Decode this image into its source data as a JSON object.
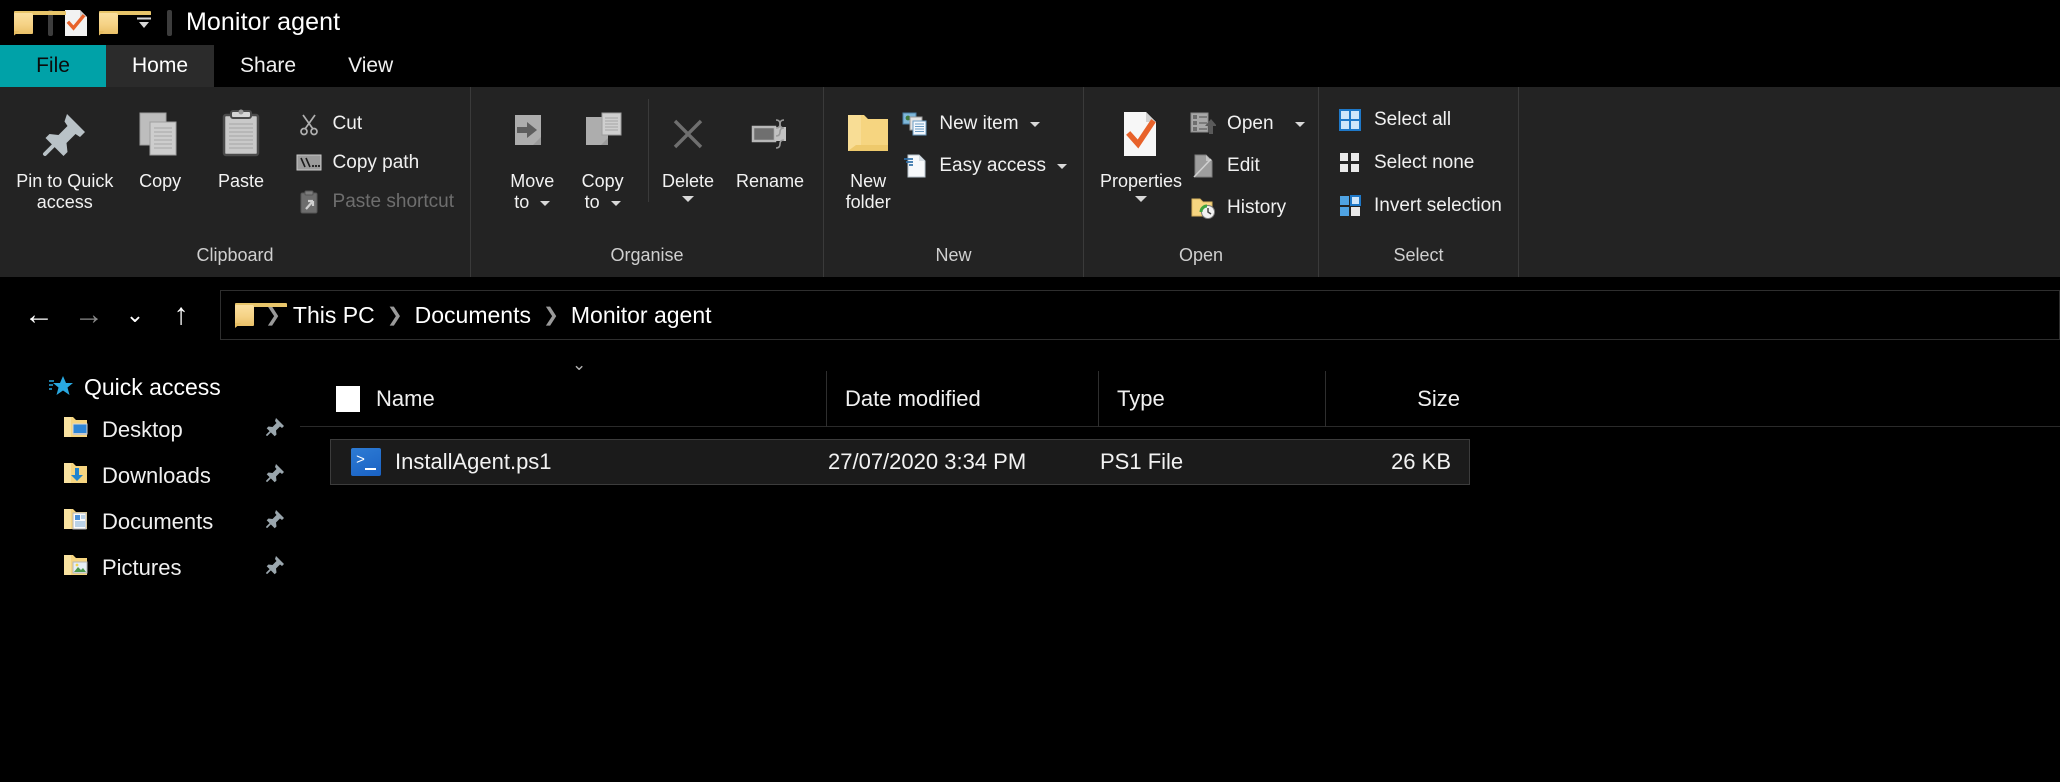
{
  "window": {
    "title": "Monitor agent",
    "accent_teal": "#00A2A8",
    "quick_access": [
      {
        "name": "folder-icon",
        "label": "New folder"
      },
      {
        "name": "properties-icon",
        "label": "Properties"
      },
      {
        "name": "folder-icon",
        "label": "Folder"
      }
    ],
    "customize_label": "Customize Quick Access Toolbar"
  },
  "tabs": [
    {
      "id": "file",
      "label": "File"
    },
    {
      "id": "home",
      "label": "Home"
    },
    {
      "id": "share",
      "label": "Share"
    },
    {
      "id": "view",
      "label": "View"
    }
  ],
  "ribbon": {
    "groups": [
      {
        "id": "clipboard",
        "label": "Clipboard",
        "big": [
          {
            "id": "pin-to-quick-access",
            "label": "Pin to Quick\naccess",
            "line1": "Pin to Quick",
            "line2": "access"
          },
          {
            "id": "copy",
            "label": "Copy"
          },
          {
            "id": "paste",
            "label": "Paste"
          }
        ],
        "small": [
          {
            "id": "cut",
            "label": "Cut",
            "enabled": true
          },
          {
            "id": "copy-path",
            "label": "Copy path",
            "enabled": true
          },
          {
            "id": "paste-shortcut",
            "label": "Paste shortcut",
            "enabled": false
          }
        ]
      },
      {
        "id": "organise",
        "label": "Organise",
        "big": [
          {
            "id": "move-to",
            "line1": "Move",
            "line2": "to",
            "has_caret": true
          },
          {
            "id": "copy-to",
            "line1": "Copy",
            "line2": "to",
            "has_caret": true
          },
          {
            "id": "delete",
            "label": "Delete",
            "has_caret": true
          },
          {
            "id": "rename",
            "label": "Rename",
            "has_caret": false
          }
        ]
      },
      {
        "id": "new",
        "label": "New",
        "big": [
          {
            "id": "new-folder",
            "line1": "New",
            "line2": "folder"
          }
        ],
        "small": [
          {
            "id": "new-item",
            "label": "New item",
            "has_caret": true
          },
          {
            "id": "easy-access",
            "label": "Easy access",
            "has_caret": true
          }
        ]
      },
      {
        "id": "open",
        "label": "Open",
        "big": [
          {
            "id": "properties",
            "label": "Properties",
            "has_caret": true
          }
        ],
        "small": [
          {
            "id": "open",
            "label": "Open",
            "has_caret": true
          },
          {
            "id": "edit",
            "label": "Edit",
            "has_caret": false
          },
          {
            "id": "history",
            "label": "History",
            "has_caret": false
          }
        ]
      },
      {
        "id": "select",
        "label": "Select",
        "small": [
          {
            "id": "select-all",
            "label": "Select all"
          },
          {
            "id": "select-none",
            "label": "Select none"
          },
          {
            "id": "invert-selection",
            "label": "Invert selection"
          }
        ]
      }
    ]
  },
  "navigation": {
    "back_icon": "←",
    "forward_icon": "→",
    "recent_icon": "⌄",
    "up_icon": "↑",
    "breadcrumb": [
      "This PC",
      "Documents",
      "Monitor agent"
    ],
    "separator": "❯"
  },
  "sidebar": {
    "root": {
      "label": "Quick access",
      "icon": "star-icon"
    },
    "items": [
      {
        "label": "Desktop",
        "icon": "folder-desktop-icon",
        "pinned": true
      },
      {
        "label": "Downloads",
        "icon": "folder-downloads-icon",
        "pinned": true
      },
      {
        "label": "Documents",
        "icon": "folder-documents-icon",
        "pinned": true
      },
      {
        "label": "Pictures",
        "icon": "folder-pictures-icon",
        "pinned": true
      }
    ]
  },
  "filelist": {
    "columns": [
      {
        "id": "name",
        "label": "Name"
      },
      {
        "id": "date",
        "label": "Date modified"
      },
      {
        "id": "type",
        "label": "Type"
      },
      {
        "id": "size",
        "label": "Size"
      }
    ],
    "rows": [
      {
        "name": "InstallAgent.ps1",
        "date_modified": "27/07/2020 3:34 PM",
        "type": "PS1 File",
        "size": "26 KB",
        "icon": "powershell-icon",
        "selected": true
      }
    ]
  }
}
